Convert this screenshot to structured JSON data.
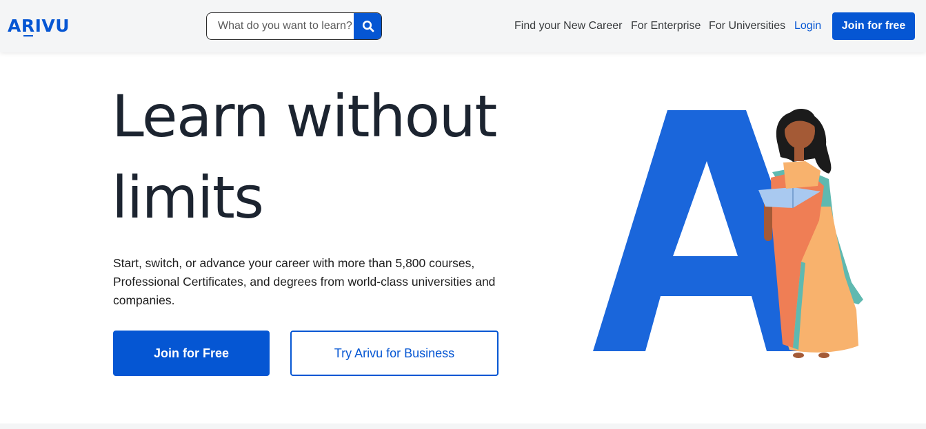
{
  "header": {
    "logo_text": "ARIVU",
    "search": {
      "placeholder": "What do you want to learn?",
      "value": "",
      "icon": "search-icon"
    },
    "nav": [
      {
        "label": "Find your New Career"
      },
      {
        "label": "For Enterprise"
      },
      {
        "label": "For Universities"
      },
      {
        "label": "Login"
      }
    ],
    "join_label": "Join for free"
  },
  "hero": {
    "title_line1": "Learn without",
    "title_line2": "limits",
    "subtitle": "Start, switch, or advance your career with more than 5,800 courses, Professional Certificates, and degrees from world-class universities and companies.",
    "primary_button": "Join for Free",
    "secondary_button": "Try Arivu for Business"
  },
  "colors": {
    "brand": "#0556d3",
    "letter_blue": "#1a66db",
    "heading": "#1c2430",
    "header_bg": "#f4f5f6"
  }
}
